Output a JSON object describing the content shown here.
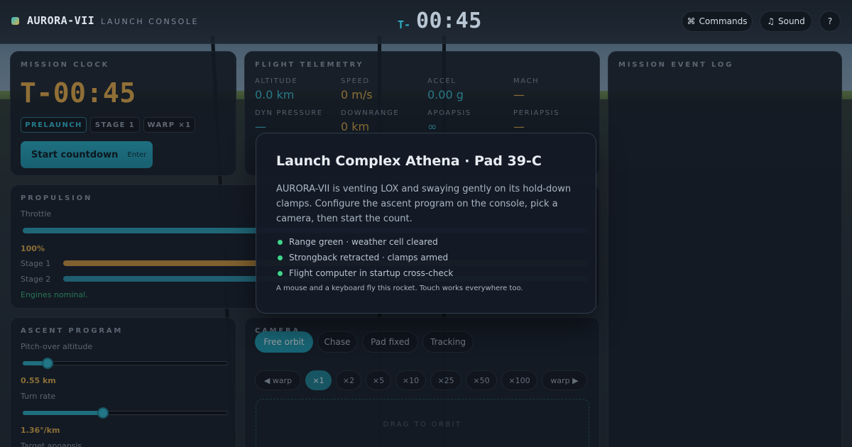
{
  "header": {
    "brand": "AURORA-VII",
    "subtitle": "LAUNCH CONSOLE",
    "clock_prefix": "T-",
    "clock": "00:45",
    "commands_icon": "command-icon",
    "commands_label": "Commands",
    "sound_icon": "music-note-icon",
    "sound_label": "Sound",
    "help_label": "?"
  },
  "mission_clock": {
    "title": "MISSION CLOCK",
    "time": "T-00:45",
    "tags": [
      "PRELAUNCH",
      "STAGE 1",
      "WARP ×1"
    ],
    "active_tag": 0,
    "start_label": "Start countdown",
    "start_shortcut": "Enter"
  },
  "telemetry": {
    "title": "FLIGHT TELEMETRY",
    "fields": [
      {
        "label": "ALTITUDE",
        "value": "0.0 km",
        "color": "#3bb7cb"
      },
      {
        "label": "SPEED",
        "value": "0 m/s",
        "color": "#d8a64a"
      },
      {
        "label": "ACCEL",
        "value": "0.00 g",
        "color": "#3bb7cb"
      },
      {
        "label": "MACH",
        "value": "—",
        "color": "#d8a64a"
      },
      {
        "label": "DYN PRESSURE",
        "value": "—",
        "color": "#3bb7cb"
      },
      {
        "label": "DOWNRANGE",
        "value": "0 km",
        "color": "#d8a64a"
      },
      {
        "label": "APOAPSIS",
        "value": "∞",
        "color": "#3bb7cb"
      },
      {
        "label": "PERIAPSIS",
        "value": "—",
        "color": "#d8a64a"
      }
    ]
  },
  "event_log": {
    "title": "MISSION EVENT LOG"
  },
  "propulsion": {
    "title": "PROPULSION",
    "throttle_label": "Throttle",
    "throttle_value": "100%",
    "throttle_fraction": 1.0,
    "stage1_label": "Stage 1",
    "stage2_label": "Stage 2",
    "status": "Engines nominal.",
    "stage1_color": "#c8923c",
    "stage2_color": "#2a8fa5"
  },
  "ascent": {
    "title": "ASCENT PROGRAM",
    "pitch_label": "Pitch-over altitude",
    "pitch_value": "0.55 km",
    "pitch_fraction": 0.12,
    "turn_label": "Turn rate",
    "turn_value": "1.36°/km",
    "turn_fraction": 0.39,
    "apo_label": "Target apoapsis"
  },
  "camera": {
    "title": "CAMERA",
    "modes": [
      "Free orbit",
      "Chase",
      "Pad fixed",
      "Tracking"
    ],
    "active_mode": 0,
    "warp_prev": "◀ warp",
    "warp_levels": [
      "×1",
      "×2",
      "×5",
      "×10",
      "×25",
      "×50",
      "×100"
    ],
    "active_warp": 0,
    "warp_next": "warp ▶",
    "drag_hint": "DRAG TO ORBIT"
  },
  "modal": {
    "title": "Launch Complex Athena · Pad 39-C",
    "body": "AURORA-VII is venting LOX and swaying gently on its hold-down clamps. Configure the ascent program on the console, pick a camera, then start the count.",
    "checks": [
      "Range green · weather cell cleared",
      "Strongback retracted · clamps armed",
      "Flight computer in startup cross-check"
    ],
    "footer": "A mouse and a keyboard fly this rocket. Touch works everywhere too.",
    "accent": "#3fd68a"
  }
}
